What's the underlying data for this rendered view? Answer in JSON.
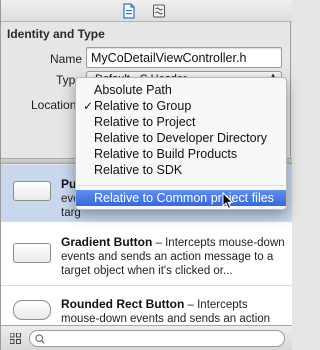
{
  "toolbar": {
    "icons": [
      "file-inspector-icon",
      "library-icon"
    ]
  },
  "inspector": {
    "section_title": "Identity and Type",
    "name_label": "Name",
    "name_value": "MyCoDetailViewController.h",
    "type_label": "Type",
    "type_value": "Default - C Header",
    "location_label": "Location"
  },
  "location_menu": {
    "items": [
      {
        "label": "Absolute Path",
        "checked": false
      },
      {
        "label": "Relative to Group",
        "checked": true
      },
      {
        "label": "Relative to Project",
        "checked": false
      },
      {
        "label": "Relative to Developer Directory",
        "checked": false
      },
      {
        "label": "Relative to Build Products",
        "checked": false
      },
      {
        "label": "Relative to SDK",
        "checked": false
      },
      {
        "label": "Relative to Common project files",
        "checked": false,
        "highlighted": true
      }
    ],
    "check_mark": "✓",
    "highlight_color": "#3a6de0"
  },
  "library": {
    "items": [
      {
        "title": "Pu",
        "desc_lines": [
          "eve",
          "targ"
        ]
      },
      {
        "title": "Gradient Button",
        "desc": " – Intercepts mouse-down events and sends an action message to a target object when it's clicked or..."
      },
      {
        "title": "Rounded Rect Button",
        "desc": " – Intercepts mouse-down events and sends an action"
      }
    ]
  }
}
